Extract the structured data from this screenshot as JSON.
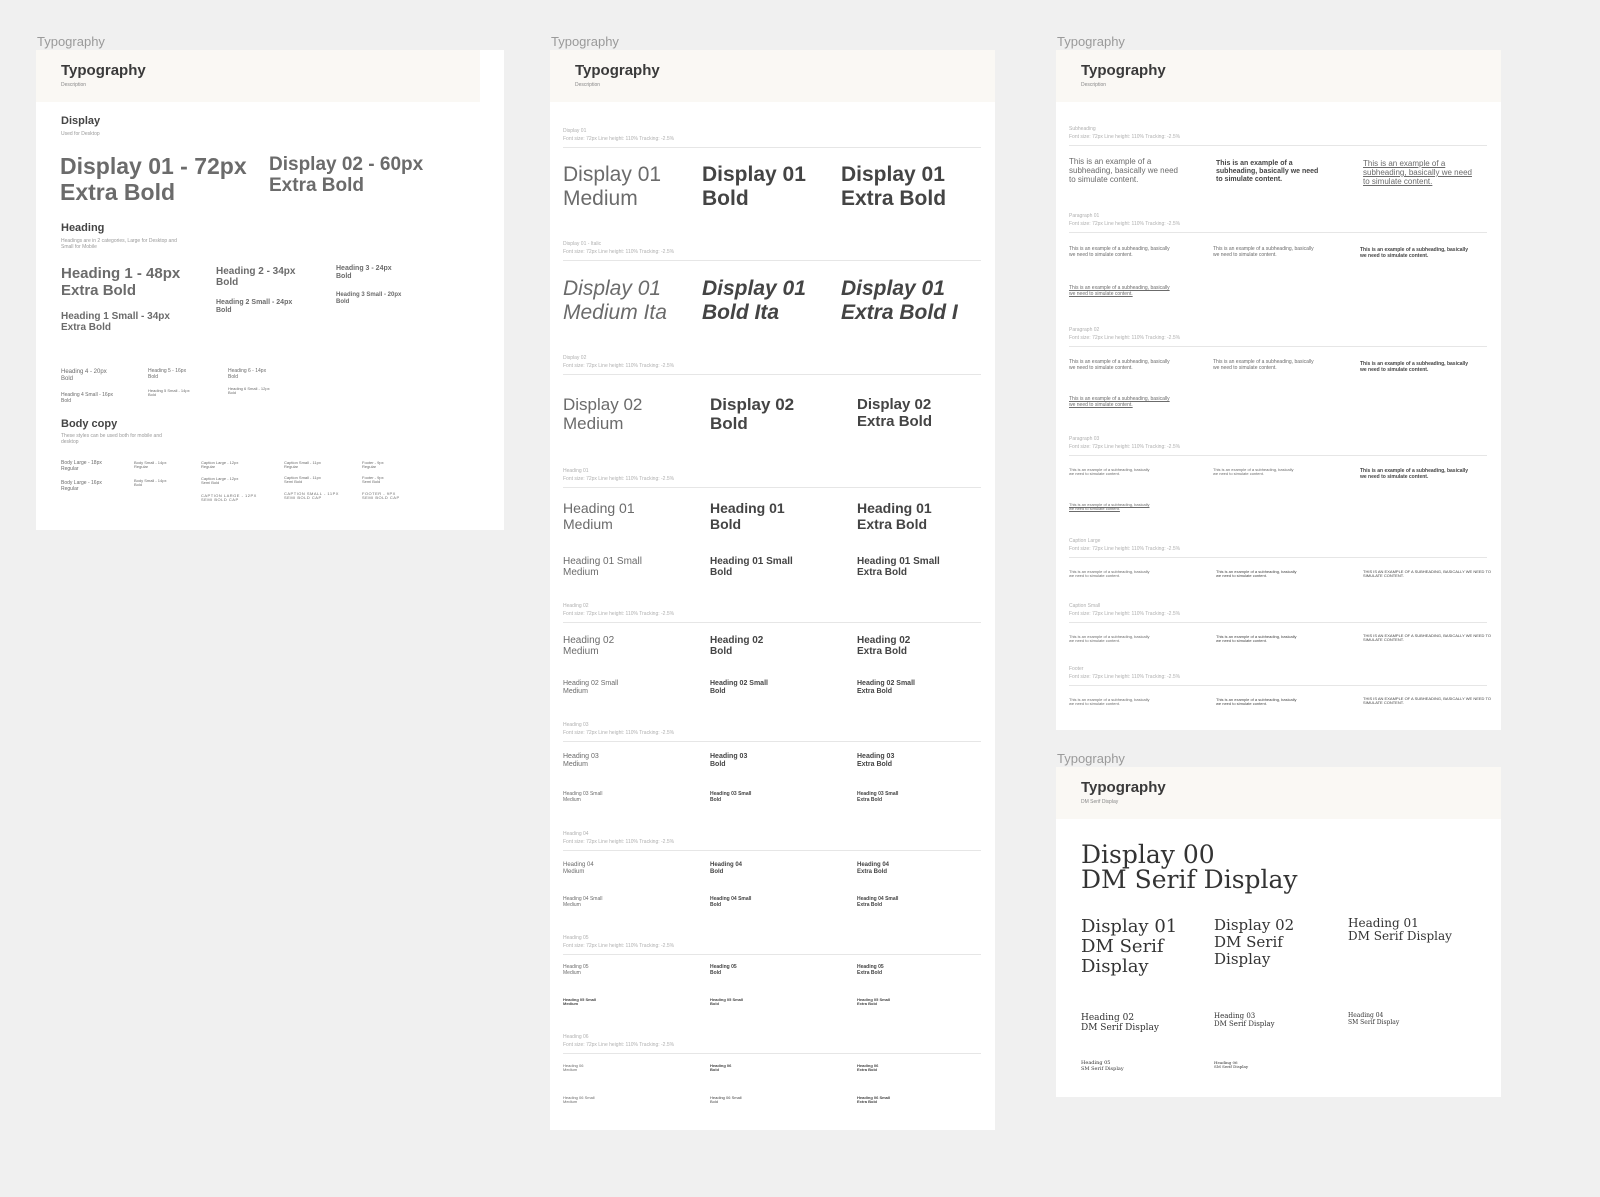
{
  "frame_label": "Typography",
  "frame1": {
    "title": "Typography",
    "desc": "Description",
    "display_title": "Display",
    "display_sub": "Used for Desktop",
    "display01": "Display 01 - 72px\nExtra Bold",
    "display02": "Display 02 - 60px\nExtra Bold",
    "heading_title": "Heading",
    "heading_sub": "Headings are in 2 categories, Large for Desktop and\nSmall for Mobile",
    "h1": "Heading 1 - 48px\nExtra Bold",
    "h1s": "Heading 1 Small - 34px\nExtra Bold",
    "h2": "Heading 2 - 34px\nBold",
    "h2s": "Heading 2 Small - 24px\nBold",
    "h3": "Heading 3 - 24px\nBold",
    "h3s": "Heading 3 Small - 20px\nBold",
    "h4": "Heading 4 - 20px\nBold",
    "h4s": "Heading 4 Small - 16px\nBold",
    "h5": "Heading 5 - 16px\nBold",
    "h5s": "Heading 5 Small - 14px\nBold",
    "h6": "Heading 6 - 14px\nBold",
    "h6s": "Heading 6 Small - 12px\nBold",
    "body_title": "Body copy",
    "body_sub": "These styles can be used both for mobile and\ndesktop",
    "b1": "Body Large - 18px\nRegular",
    "b2": "Body Large - 16px\nRegular",
    "b3": "Body Small - 14px\nRegular",
    "b4": "Body Small - 14px\nBold",
    "b5": "Caption Large - 12px\nRegular",
    "b6": "Caption Large - 12px\nSemi Bold",
    "b7": "CAPTION LARGE - 12PX\nSEMI BOLD CAP",
    "b8": "Caption Small - 11px\nRegular",
    "b9": "Caption Small - 11px\nSemi Bold",
    "b10": "CAPTION SMALL - 11PX\nSEMI BOLD CAP",
    "b11": "Footer - 9px\nRegular",
    "b12": "Footer - 9px\nSemi Bold",
    "b13": "FOOTER - 9PX\nSEMI BOLD CAP"
  },
  "frame2": {
    "title": "Typography",
    "desc": "Description",
    "spec": "Font size: 72px Line height: 110% Tracking: -2.5%",
    "sections": [
      {
        "label": "Display 01",
        "items": [
          "Display 01\nMedium",
          "Display 01\nBold",
          "Display 01\nExtra Bold"
        ]
      },
      {
        "label": "Display 01 - Italic",
        "items": [
          "Display 01\nMedium Ita",
          "Display 01\nBold Ita",
          "Display 01\nExtra Bold I"
        ]
      },
      {
        "label": "Display 02",
        "items": [
          "Display 02\nMedium",
          "Display 02\nBold",
          "Display 02\nExtra Bold"
        ]
      },
      {
        "label": "Heading 01",
        "items": [
          "Heading 01\nMedium",
          "Heading 01\nBold",
          "Heading 01\nExtra Bold"
        ],
        "small": [
          "Heading 01 Small\nMedium",
          "Heading 01 Small\nBold",
          "Heading 01 Small\nExtra Bold"
        ]
      },
      {
        "label": "Heading 02",
        "items": [
          "Heading 02\nMedium",
          "Heading 02\nBold",
          "Heading 02\nExtra Bold"
        ],
        "small": [
          "Heading 02 Small\nMedium",
          "Heading 02 Small\nBold",
          "Heading 02 Small\nExtra Bold"
        ]
      },
      {
        "label": "Heading 03",
        "items": [
          "Heading 03\nMedium",
          "Heading 03\nBold",
          "Heading 03\nExtra Bold"
        ],
        "small": [
          "Heading 03 Small\nMedium",
          "Heading 03 Small\nBold",
          "Heading 03 Small\nExtra Bold"
        ]
      },
      {
        "label": "Heading 04",
        "items": [
          "Heading 04\nMedium",
          "Heading 04\nBold",
          "Heading 04\nExtra Bold"
        ],
        "small": [
          "Heading 04 Small\nMedium",
          "Heading 04 Small\nBold",
          "Heading 04 Small\nExtra Bold"
        ]
      },
      {
        "label": "Heading 05",
        "items": [
          "Heading 05\nMedium",
          "Heading 05\nBold",
          "Heading 05\nExtra Bold"
        ],
        "small": [
          "Heading 05 Small\nMedium",
          "Heading 05 Small\nBold",
          "Heading 05 Small\nExtra Bold"
        ]
      },
      {
        "label": "Heading 06",
        "items": [
          "Heading 06\nMedium",
          "Heading 06\nBold",
          "Heading 06\nExtra Bold"
        ],
        "small": [
          "Heading 06 Small\nMedium",
          "Heading 06 Small\nBold",
          "Heading 06 Small\nExtra Bold"
        ]
      }
    ]
  },
  "frame3": {
    "title": "Typography",
    "desc": "Description",
    "spec": "Font size: 72px Line height: 110% Tracking: -2.5%",
    "example": "This is an example of a\nsubheading, basically we need\nto simulate content.",
    "example_line": "This is an example of a subheading, basically\nwe need to simulate content.",
    "example_cap": "THIS IS AN EXAMPLE OF A SUBHEADING, BASICALLY WE NEED TO\nSIMULATE CONTENT.",
    "sections": [
      "Subheading",
      "Paragraph 01",
      "Paragraph 02",
      "Paragraph 03",
      "Caption Large",
      "Caption Small",
      "Footer"
    ]
  },
  "frame4": {
    "title": "Typography",
    "desc": "DM Serif Display",
    "d00": "Display 00\nDM Serif Display",
    "d01": "Display 01\nDM Serif\nDisplay",
    "d02": "Display 02\nDM Serif\nDisplay",
    "h01": "Heading 01\nDM Serif Display",
    "h02": "Heading 02\nDM Serif Display",
    "h03": "Heading 03\nDM Serif Display",
    "h04": "Heading 04\nSM Serif Display",
    "h05": "Heading 05\nSM Serif Display",
    "h06": "Heading 06\nSM Serif Display"
  }
}
